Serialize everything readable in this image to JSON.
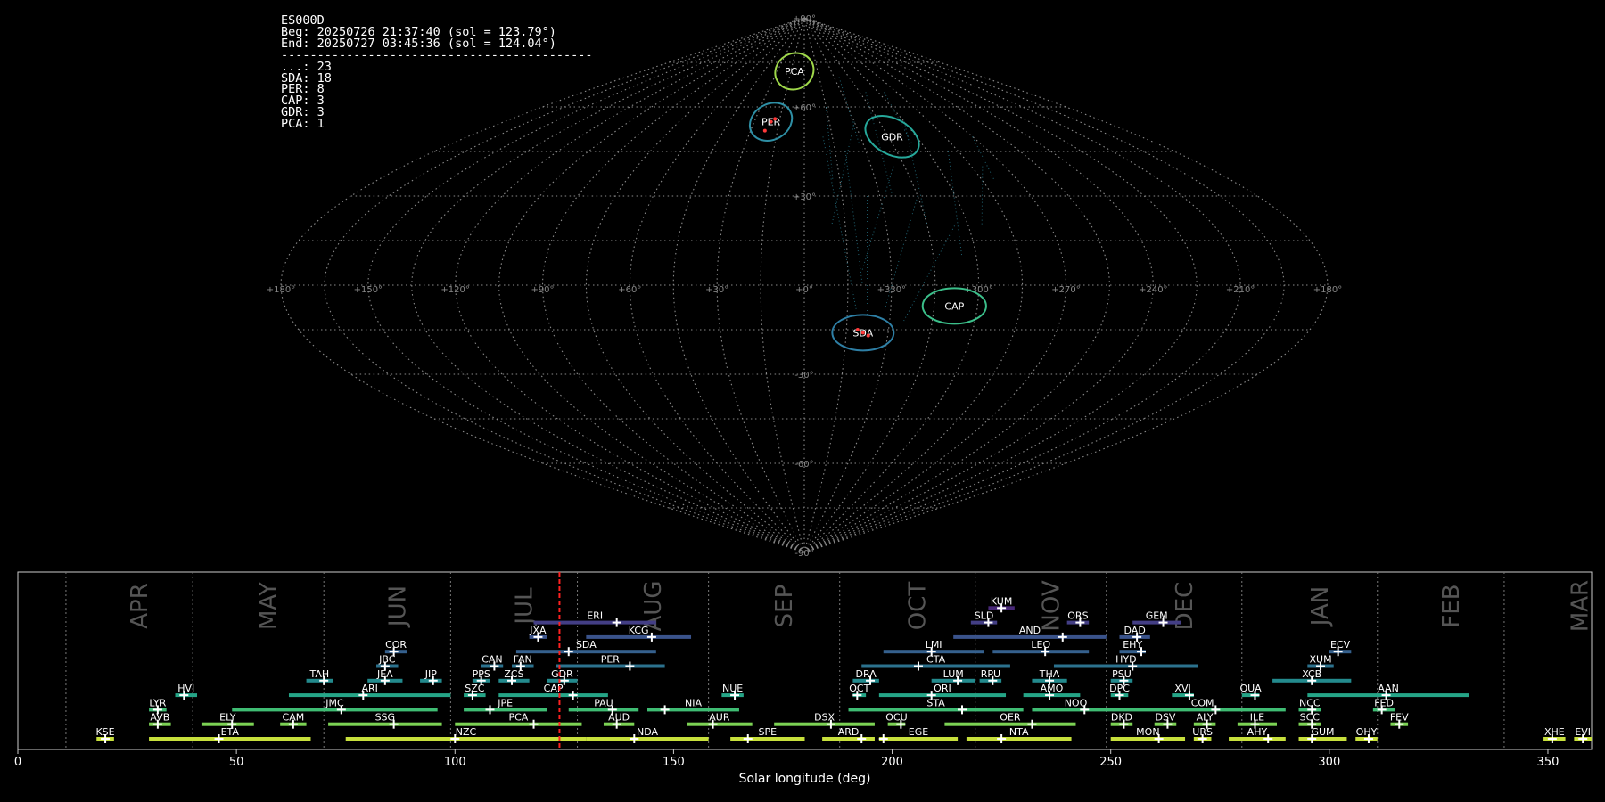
{
  "info": {
    "station": "ES000D",
    "beg": "Beg: 20250726 21:37:40 (sol = 123.79°)",
    "end": "End: 20250727 03:45:36 (sol = 124.04°)",
    "separator": "-------------------------------------------",
    "counts": [
      {
        "code": "...",
        "n": 23
      },
      {
        "code": "SDA",
        "n": 18
      },
      {
        "code": "PER",
        "n": 8
      },
      {
        "code": "CAP",
        "n": 3
      },
      {
        "code": "GDR",
        "n": 3
      },
      {
        "code": "PCA",
        "n": 1
      }
    ]
  },
  "chart_data": [
    {
      "type": "scatter",
      "projection": "sinusoidal",
      "lon_range": [
        180,
        -180
      ],
      "lat_range": [
        -90,
        90
      ],
      "grid": true,
      "lon_tick_labels": [
        "+180°",
        "+150°",
        "+120°",
        "+90°",
        "+60°",
        "+30°",
        "+0°",
        "+330°",
        "+300°",
        "+270°",
        "+240°",
        "+210°",
        "+180°"
      ],
      "lat_tick_labels": [
        "+90°",
        "+60°",
        "+30°",
        "-30°",
        "-60°",
        "-90°"
      ],
      "radiants": [
        {
          "code": "PCA",
          "lon": 11,
          "lat": 72,
          "r": 6,
          "color": "#9fd84a"
        },
        {
          "code": "PER",
          "lon": 20,
          "lat": 55,
          "r": 6,
          "color": "#2e8fa5"
        },
        {
          "code": "GDR",
          "lon": -47,
          "lat": 50,
          "r": 7,
          "color": "#26a89a"
        },
        {
          "code": "CAP",
          "lon": -52,
          "lat": -7,
          "r": 5,
          "color": "#3bbf8a"
        },
        {
          "code": "SDA",
          "lon": -21,
          "lat": -16,
          "r": 5,
          "color": "#2e7fa5"
        }
      ]
    },
    {
      "type": "gantt",
      "xlabel": "Solar longitude (deg)",
      "xlim": [
        0,
        360
      ],
      "xticks": [
        0,
        50,
        100,
        150,
        200,
        250,
        300,
        350
      ],
      "current_sol": 123.9,
      "months": [
        {
          "name": "APR",
          "start": 11
        },
        {
          "name": "MAY",
          "start": 40
        },
        {
          "name": "JUN",
          "start": 70
        },
        {
          "name": "JUL",
          "start": 99
        },
        {
          "name": "AUG",
          "start": 128
        },
        {
          "name": "SEP",
          "start": 158
        },
        {
          "name": "OCT",
          "start": 188
        },
        {
          "name": "NOV",
          "start": 219
        },
        {
          "name": "DEC",
          "start": 249
        },
        {
          "name": "JAN",
          "start": 280
        },
        {
          "name": "FEB",
          "start": 311
        },
        {
          "name": "MAR",
          "start": 340
        }
      ],
      "showers": [
        {
          "code": "KUM",
          "start": 222,
          "end": 228,
          "peak": 225,
          "row": 10
        },
        {
          "code": "ERI",
          "start": 118,
          "end": 146,
          "peak": 137,
          "row": 9
        },
        {
          "code": "SLD",
          "start": 218,
          "end": 224,
          "peak": 222,
          "row": 9
        },
        {
          "code": "ORS",
          "start": 240,
          "end": 245,
          "peak": 243,
          "row": 9
        },
        {
          "code": "GEM",
          "start": 255,
          "end": 266,
          "peak": 262,
          "row": 9
        },
        {
          "code": "JXA",
          "start": 117,
          "end": 121,
          "peak": 119,
          "row": 8
        },
        {
          "code": "KCG",
          "start": 130,
          "end": 154,
          "peak": 145,
          "row": 8
        },
        {
          "code": "AND",
          "start": 214,
          "end": 249,
          "peak": 239,
          "row": 8
        },
        {
          "code": "DAD",
          "start": 252,
          "end": 259,
          "peak": 256,
          "row": 8
        },
        {
          "code": "COR",
          "start": 84,
          "end": 89,
          "peak": 86,
          "row": 7
        },
        {
          "code": "SDA",
          "start": 114,
          "end": 146,
          "peak": 126,
          "row": 7
        },
        {
          "code": "LMI",
          "start": 198,
          "end": 221,
          "peak": 209,
          "row": 7
        },
        {
          "code": "LEO",
          "start": 223,
          "end": 245,
          "peak": 235,
          "row": 7
        },
        {
          "code": "EHY",
          "start": 252,
          "end": 258,
          "peak": 257,
          "row": 7
        },
        {
          "code": "ECV",
          "start": 300,
          "end": 305,
          "peak": 302,
          "row": 7
        },
        {
          "code": "JBC",
          "start": 82,
          "end": 87,
          "peak": 84,
          "row": 6
        },
        {
          "code": "CAN",
          "start": 106,
          "end": 111,
          "peak": 109,
          "row": 6
        },
        {
          "code": "FAN",
          "start": 113,
          "end": 118,
          "peak": 115,
          "row": 6
        },
        {
          "code": "PER",
          "start": 123,
          "end": 148,
          "peak": 140,
          "row": 6
        },
        {
          "code": "CTA",
          "start": 193,
          "end": 227,
          "peak": 206,
          "row": 6
        },
        {
          "code": "HYD",
          "start": 237,
          "end": 270,
          "peak": 255,
          "row": 6
        },
        {
          "code": "XUM",
          "start": 295,
          "end": 301,
          "peak": 298,
          "row": 6
        },
        {
          "code": "TAH",
          "start": 66,
          "end": 72,
          "peak": 70,
          "row": 5
        },
        {
          "code": "JEA",
          "start": 80,
          "end": 88,
          "peak": 84,
          "row": 5
        },
        {
          "code": "JIP",
          "start": 92,
          "end": 97,
          "peak": 95,
          "row": 5
        },
        {
          "code": "PPS",
          "start": 104,
          "end": 108,
          "peak": 106,
          "row": 5
        },
        {
          "code": "ZCS",
          "start": 110,
          "end": 117,
          "peak": 113,
          "row": 5
        },
        {
          "code": "GDR",
          "start": 121,
          "end": 128,
          "peak": 125,
          "row": 5
        },
        {
          "code": "DRA",
          "start": 191,
          "end": 197,
          "peak": 195,
          "row": 5
        },
        {
          "code": "LUM",
          "start": 209,
          "end": 219,
          "peak": 215,
          "row": 5
        },
        {
          "code": "RPU",
          "start": 220,
          "end": 225,
          "peak": 223,
          "row": 5
        },
        {
          "code": "THA",
          "start": 232,
          "end": 240,
          "peak": 236,
          "row": 5
        },
        {
          "code": "PSU",
          "start": 250,
          "end": 255,
          "peak": 253,
          "row": 5
        },
        {
          "code": "XCB",
          "start": 287,
          "end": 305,
          "peak": 296,
          "row": 5
        },
        {
          "code": "HVI",
          "start": 36,
          "end": 41,
          "peak": 38,
          "row": 4
        },
        {
          "code": "ARI",
          "start": 62,
          "end": 99,
          "peak": 79,
          "row": 4
        },
        {
          "code": "SZC",
          "start": 102,
          "end": 107,
          "peak": 104,
          "row": 4
        },
        {
          "code": "CAP",
          "start": 110,
          "end": 135,
          "peak": 127,
          "row": 4
        },
        {
          "code": "NUE",
          "start": 161,
          "end": 166,
          "peak": 164,
          "row": 4
        },
        {
          "code": "OCT",
          "start": 191,
          "end": 194,
          "peak": 192,
          "row": 4
        },
        {
          "code": "ORI",
          "start": 197,
          "end": 226,
          "peak": 209,
          "row": 4
        },
        {
          "code": "AMO",
          "start": 230,
          "end": 243,
          "peak": 236,
          "row": 4
        },
        {
          "code": "DPC",
          "start": 250,
          "end": 254,
          "peak": 252,
          "row": 4
        },
        {
          "code": "XVI",
          "start": 264,
          "end": 269,
          "peak": 268,
          "row": 4
        },
        {
          "code": "QUA",
          "start": 280,
          "end": 284,
          "peak": 283,
          "row": 4
        },
        {
          "code": "AAN",
          "start": 295,
          "end": 332,
          "peak": 313,
          "row": 4
        },
        {
          "code": "LYR",
          "start": 30,
          "end": 34,
          "peak": 32,
          "row": 3
        },
        {
          "code": "JMC",
          "start": 49,
          "end": 96,
          "peak": 74,
          "row": 3
        },
        {
          "code": "JPE",
          "start": 102,
          "end": 121,
          "peak": 108,
          "row": 3
        },
        {
          "code": "PAU",
          "start": 126,
          "end": 142,
          "peak": 136,
          "row": 3
        },
        {
          "code": "NIA",
          "start": 144,
          "end": 165,
          "peak": 148,
          "row": 3
        },
        {
          "code": "STA",
          "start": 190,
          "end": 230,
          "peak": 216,
          "row": 3
        },
        {
          "code": "NOO",
          "start": 232,
          "end": 252,
          "peak": 244,
          "row": 3
        },
        {
          "code": "COM",
          "start": 252,
          "end": 290,
          "peak": 274,
          "row": 3
        },
        {
          "code": "NCC",
          "start": 293,
          "end": 298,
          "peak": 296,
          "row": 3
        },
        {
          "code": "FED",
          "start": 310,
          "end": 315,
          "peak": 312,
          "row": 3
        },
        {
          "code": "AVB",
          "start": 30,
          "end": 35,
          "peak": 32,
          "row": 2
        },
        {
          "code": "ELY",
          "start": 42,
          "end": 54,
          "peak": 49,
          "row": 2
        },
        {
          "code": "CAM",
          "start": 60,
          "end": 66,
          "peak": 63,
          "row": 2
        },
        {
          "code": "SSG",
          "start": 71,
          "end": 97,
          "peak": 86,
          "row": 2
        },
        {
          "code": "PCA",
          "start": 100,
          "end": 129,
          "peak": 118,
          "row": 2
        },
        {
          "code": "AUD",
          "start": 134,
          "end": 141,
          "peak": 137,
          "row": 2
        },
        {
          "code": "AUR",
          "start": 153,
          "end": 168,
          "peak": 159,
          "row": 2
        },
        {
          "code": "DSX",
          "start": 173,
          "end": 196,
          "peak": 186,
          "row": 2
        },
        {
          "code": "OCU",
          "start": 199,
          "end": 203,
          "peak": 202,
          "row": 2
        },
        {
          "code": "OER",
          "start": 212,
          "end": 242,
          "peak": 232,
          "row": 2
        },
        {
          "code": "DKD",
          "start": 250,
          "end": 255,
          "peak": 253,
          "row": 2
        },
        {
          "code": "DSV",
          "start": 260,
          "end": 265,
          "peak": 263,
          "row": 2
        },
        {
          "code": "ALY",
          "start": 269,
          "end": 274,
          "peak": 272,
          "row": 2
        },
        {
          "code": "ILE",
          "start": 279,
          "end": 288,
          "peak": 283,
          "row": 2
        },
        {
          "code": "SCC",
          "start": 293,
          "end": 298,
          "peak": 296,
          "row": 2
        },
        {
          "code": "FEV",
          "start": 314,
          "end": 318,
          "peak": 316,
          "row": 2
        },
        {
          "code": "KSE",
          "start": 18,
          "end": 22,
          "peak": 20,
          "row": 1
        },
        {
          "code": "ETA",
          "start": 30,
          "end": 67,
          "peak": 46,
          "row": 1
        },
        {
          "code": "NZC",
          "start": 75,
          "end": 130,
          "peak": 100,
          "row": 1
        },
        {
          "code": "NDA",
          "start": 130,
          "end": 158,
          "peak": 141,
          "row": 1
        },
        {
          "code": "SPE",
          "start": 163,
          "end": 180,
          "peak": 167,
          "row": 1
        },
        {
          "code": "ARD",
          "start": 184,
          "end": 196,
          "peak": 193,
          "row": 1
        },
        {
          "code": "EGE",
          "start": 197,
          "end": 215,
          "peak": 198,
          "row": 1
        },
        {
          "code": "NTA",
          "start": 217,
          "end": 241,
          "peak": 225,
          "row": 1
        },
        {
          "code": "MON",
          "start": 250,
          "end": 267,
          "peak": 261,
          "row": 1
        },
        {
          "code": "URS",
          "start": 269,
          "end": 273,
          "peak": 271,
          "row": 1
        },
        {
          "code": "AHY",
          "start": 277,
          "end": 290,
          "peak": 286,
          "row": 1
        },
        {
          "code": "GUM",
          "start": 293,
          "end": 304,
          "peak": 296,
          "row": 1
        },
        {
          "code": "OHY",
          "start": 306,
          "end": 311,
          "peak": 309,
          "row": 1
        },
        {
          "code": "XHE",
          "start": 349,
          "end": 354,
          "peak": 351,
          "row": 1
        },
        {
          "code": "EVI",
          "start": 356,
          "end": 360,
          "peak": 358,
          "row": 1
        }
      ]
    }
  ]
}
